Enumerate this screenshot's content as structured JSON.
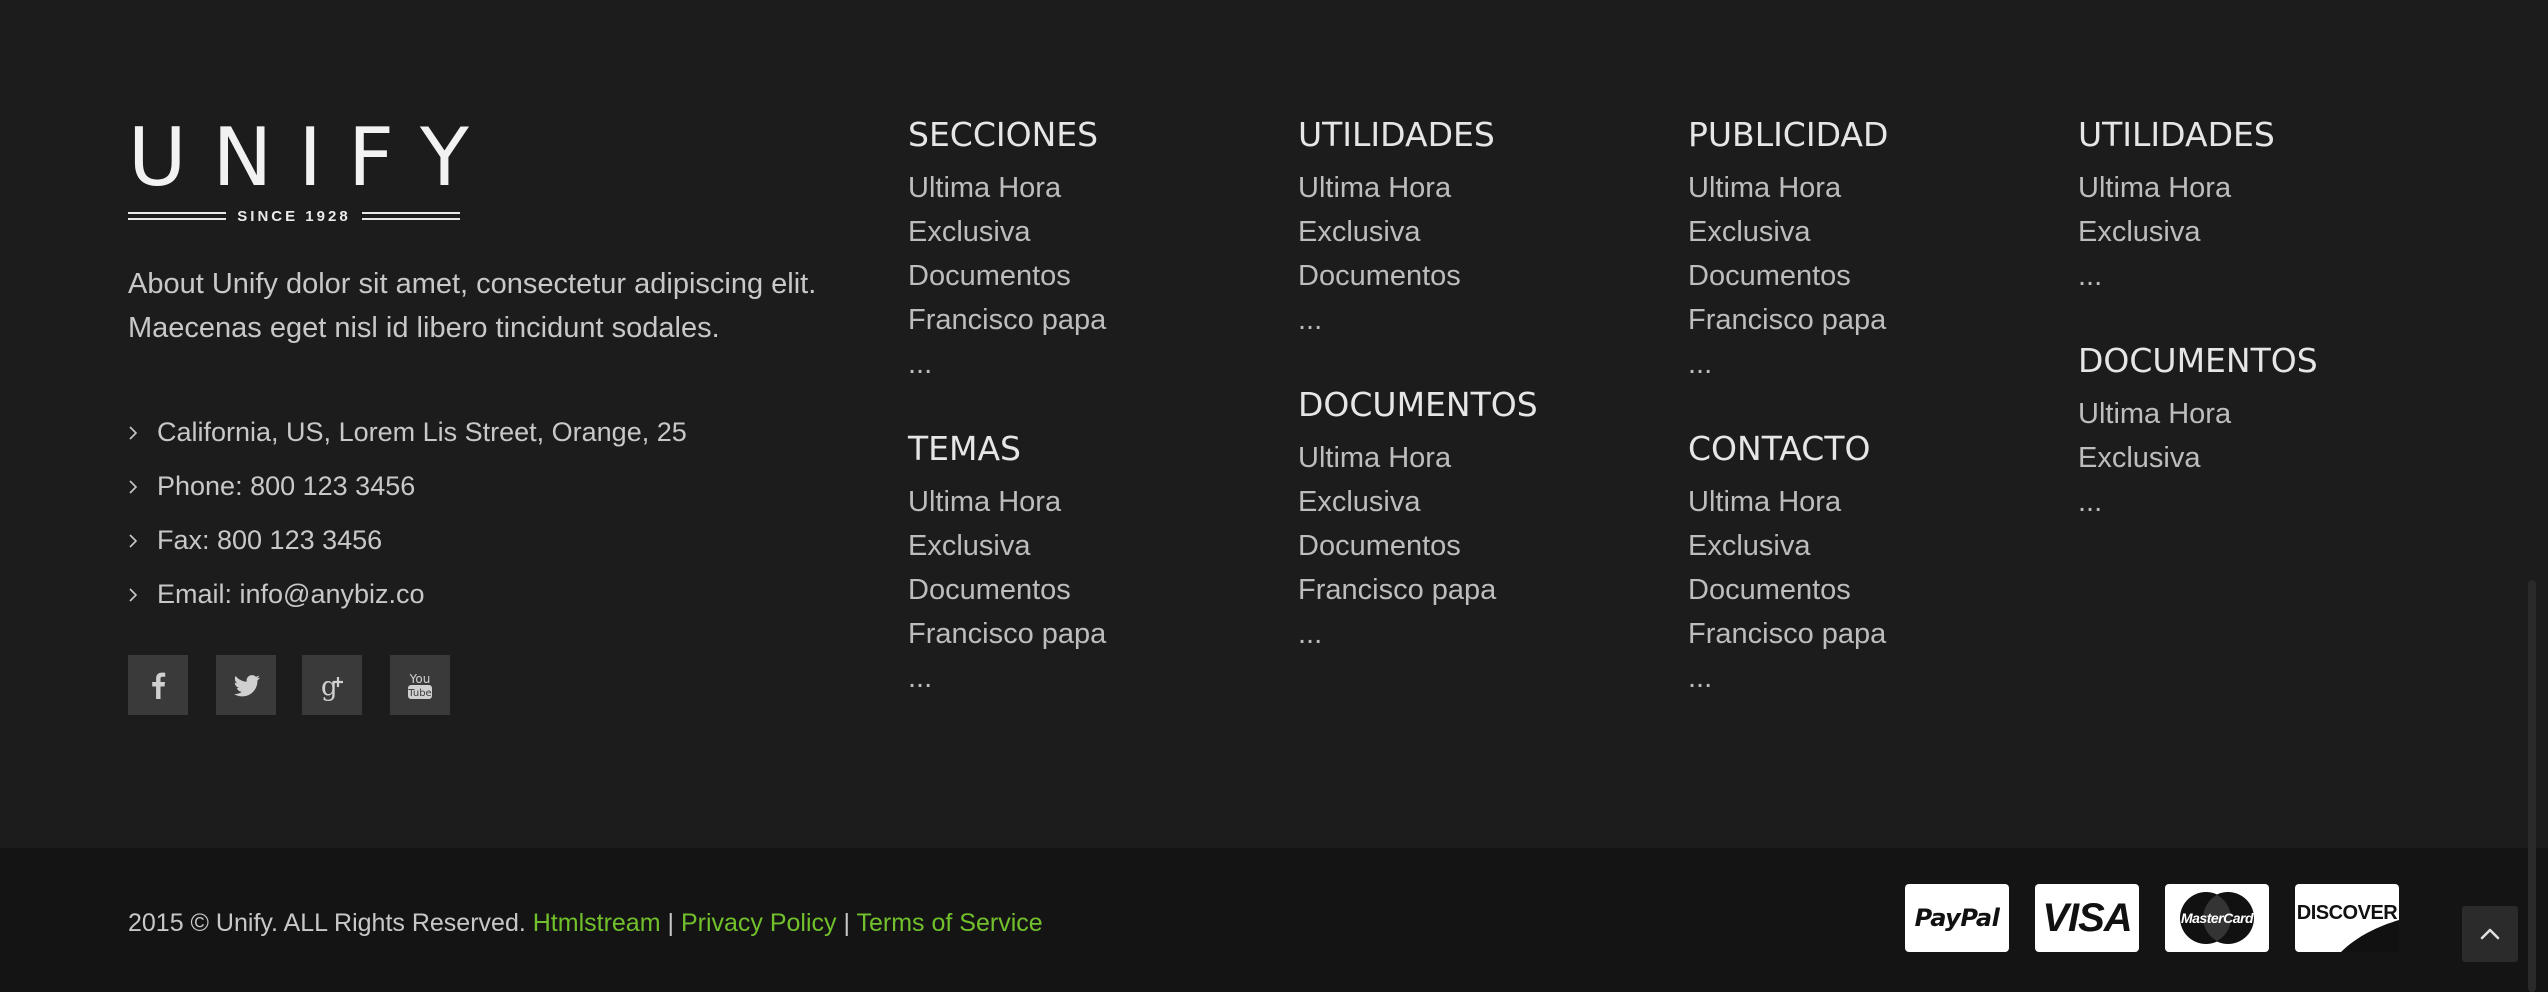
{
  "logo": {
    "wordmark": "UNIFY",
    "tagline": "SINCE 1928"
  },
  "about": "About Unify dolor sit amet, consectetur adipiscing elit. Maecenas eget nisl id libero tincidunt sodales.",
  "contact": [
    "California, US, Lorem Lis Street, Orange, 25",
    "Phone: 800 123 3456",
    "Fax: 800 123 3456",
    "Email: info@anybiz.co"
  ],
  "socials": [
    "facebook-icon",
    "twitter-icon",
    "google-plus-icon",
    "youtube-icon"
  ],
  "columns": [
    {
      "sections": [
        {
          "title": "SECCIONES",
          "links": [
            "Ultima Hora",
            "Exclusiva",
            "Documentos",
            "Francisco papa",
            "..."
          ]
        },
        {
          "title": "TEMAS",
          "links": [
            "Ultima Hora",
            "Exclusiva",
            "Documentos",
            "Francisco papa",
            "..."
          ]
        }
      ]
    },
    {
      "sections": [
        {
          "title": "UTILIDADES",
          "links": [
            "Ultima Hora",
            "Exclusiva",
            "Documentos",
            "..."
          ]
        },
        {
          "title": "DOCUMENTOS",
          "links": [
            "Ultima Hora",
            "Exclusiva",
            "Documentos",
            "Francisco papa",
            "..."
          ]
        }
      ]
    },
    {
      "sections": [
        {
          "title": "PUBLICIDAD",
          "links": [
            "Ultima Hora",
            "Exclusiva",
            "Documentos",
            "Francisco papa",
            "..."
          ]
        },
        {
          "title": "CONTACTO",
          "links": [
            "Ultima Hora",
            "Exclusiva",
            "Documentos",
            "Francisco papa",
            "..."
          ]
        }
      ]
    },
    {
      "sections": [
        {
          "title": "UTILIDADES",
          "links": [
            "Ultima Hora",
            "Exclusiva",
            "..."
          ]
        },
        {
          "title": "DOCUMENTOS",
          "links": [
            "Ultima Hora",
            "Exclusiva",
            "..."
          ]
        }
      ]
    }
  ],
  "bottom": {
    "copyright": "2015 © Unify. ALL Rights Reserved.",
    "links": [
      "Htmlstream",
      "Privacy Policy",
      "Terms of Service"
    ],
    "separator": "|"
  },
  "payment_cards": [
    "PayPal",
    "VISA",
    "MasterCard",
    "DISCOVER"
  ],
  "colors": {
    "accent": "#72c02c",
    "background": "#1c1c1c",
    "bottom_bar": "#141414"
  }
}
